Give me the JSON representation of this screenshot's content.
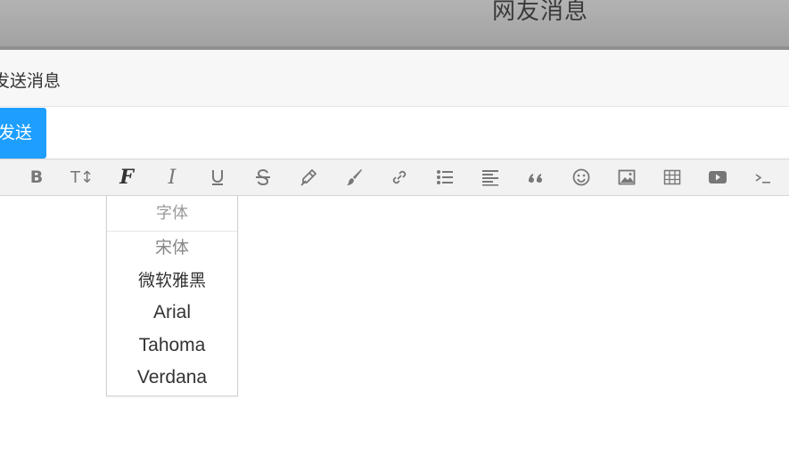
{
  "window": {
    "title": "网友消息"
  },
  "section": {
    "title": "发送消息"
  },
  "actions": {
    "send_label": "发送"
  },
  "toolbar": {
    "items": [
      {
        "icon": "bold-icon",
        "text": "B"
      },
      {
        "icon": "text-size-icon",
        "text": "T↕"
      },
      {
        "icon": "font-family-icon",
        "text": "F"
      },
      {
        "icon": "italic-icon",
        "text": "I"
      },
      {
        "icon": "underline-icon"
      },
      {
        "icon": "strikethrough-icon"
      },
      {
        "icon": "text-color-icon"
      },
      {
        "icon": "background-color-icon"
      },
      {
        "icon": "link-icon"
      },
      {
        "icon": "unordered-list-icon"
      },
      {
        "icon": "align-left-icon"
      },
      {
        "icon": "quote-icon"
      },
      {
        "icon": "emoticon-icon"
      },
      {
        "icon": "image-icon"
      },
      {
        "icon": "table-icon"
      },
      {
        "icon": "video-icon"
      },
      {
        "icon": "code-icon"
      }
    ]
  },
  "font_dropdown": {
    "title": "字体",
    "options": [
      "宋体",
      "微软雅黑",
      "Arial",
      "Tahoma",
      "Verdana"
    ]
  },
  "colors": {
    "send_button": "#1e9fff",
    "toolbar_icon": "#777777",
    "active_icon": "#333333"
  }
}
